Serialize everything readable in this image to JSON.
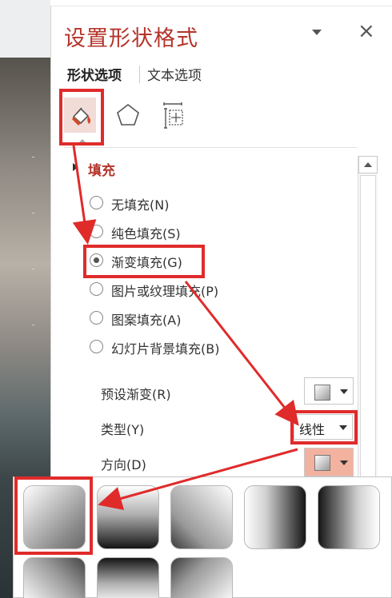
{
  "colors": {
    "title_accent": "#b5342a",
    "annotation_red": "#e02b2b",
    "selected_icon_bg": "#f2dcd8",
    "direction_dropdown_bg": "#f3b1a0"
  },
  "panel": {
    "title": "设置形状格式",
    "tabs": [
      {
        "label": "形状选项",
        "active": true
      },
      {
        "label": "文本选项",
        "active": false
      }
    ],
    "icons": [
      "fill-line-icon",
      "effects-pentagon-icon",
      "size-properties-icon"
    ],
    "selected_icon": "fill-line-icon"
  },
  "fill_section": {
    "title": "填充",
    "options": [
      {
        "label": "无填充(N)",
        "checked": false
      },
      {
        "label": "纯色填充(S)",
        "checked": false
      },
      {
        "label": "渐变填充(G)",
        "checked": true
      },
      {
        "label": "图片或纹理填充(P)",
        "checked": false
      },
      {
        "label": "图案填充(A)",
        "checked": false
      },
      {
        "label": "幻灯片背景填充(B)",
        "checked": false
      }
    ]
  },
  "gradient": {
    "preset_label": "预设渐变(R)",
    "type_label": "类型(Y)",
    "type_value": "线性",
    "direction_label": "方向(D)"
  },
  "direction_gallery": {
    "tiles": [
      {
        "name": "linear-diagonal-top-left"
      },
      {
        "name": "linear-down"
      },
      {
        "name": "linear-diagonal-top-right"
      },
      {
        "name": "linear-right"
      },
      {
        "name": "linear-left"
      },
      {
        "name": "linear-diagonal-bottom-left"
      },
      {
        "name": "linear-up"
      },
      {
        "name": "linear-diagonal-bottom-right"
      }
    ],
    "selected_index": 0
  }
}
